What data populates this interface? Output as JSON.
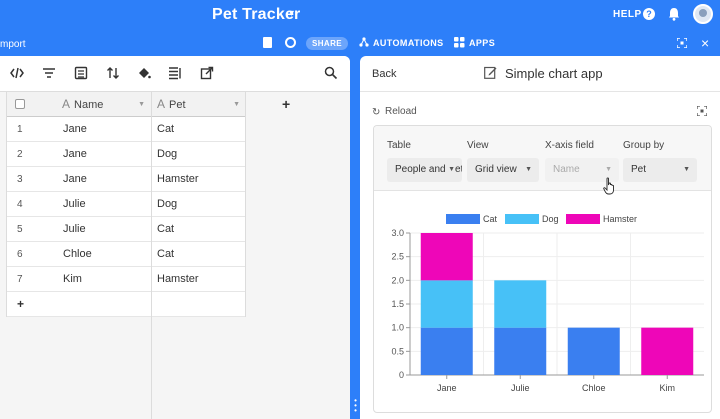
{
  "topbar": {
    "title": "Pet Tracker",
    "help": "HELP",
    "help_glyph": "?"
  },
  "subbar": {
    "import_label": "mport",
    "share_label": "SHARE",
    "automations_label": "AUTOMATIONS",
    "apps_label": "APPS",
    "close_glyph": "×"
  },
  "grid": {
    "columns": [
      {
        "name": "Name",
        "type_glyph": "A"
      },
      {
        "name": "Pet",
        "type_glyph": "A"
      }
    ],
    "rows": [
      {
        "num": "1",
        "name": "Jane",
        "pet": "Cat"
      },
      {
        "num": "2",
        "name": "Jane",
        "pet": "Dog"
      },
      {
        "num": "3",
        "name": "Jane",
        "pet": "Hamster"
      },
      {
        "num": "4",
        "name": "Julie",
        "pet": "Dog"
      },
      {
        "num": "5",
        "name": "Julie",
        "pet": "Cat"
      },
      {
        "num": "6",
        "name": "Chloe",
        "pet": "Cat"
      },
      {
        "num": "7",
        "name": "Kim",
        "pet": "Hamster"
      }
    ],
    "add_row": "+",
    "add_column": "+"
  },
  "app_panel": {
    "back_label": "Back",
    "title": "Simple chart app",
    "reload_label": "Reload",
    "reload_glyph": "↻",
    "config": {
      "table_label": "Table",
      "table_value": "People and Pets",
      "view_label": "View",
      "view_value": "Grid view",
      "xaxis_label": "X-axis field",
      "xaxis_value": "Name",
      "groupby_label": "Group by",
      "groupby_value": "Pet"
    }
  },
  "colors": {
    "accent": "#2d7ff9",
    "cat": "#3a7ff0",
    "dog": "#47c1f7",
    "hamster": "#ee06b8"
  },
  "chart_data": {
    "type": "bar",
    "stacked": true,
    "categories": [
      "Jane",
      "Julie",
      "Chloe",
      "Kim"
    ],
    "series": [
      {
        "name": "Cat",
        "color": "#3a7ff0",
        "values": [
          1,
          1,
          1,
          0
        ]
      },
      {
        "name": "Dog",
        "color": "#47c1f7",
        "values": [
          1,
          1,
          0,
          0
        ]
      },
      {
        "name": "Hamster",
        "color": "#ee06b8",
        "values": [
          1,
          0,
          0,
          1
        ]
      }
    ],
    "ylim": [
      0,
      3
    ],
    "yticks": [
      "0",
      "0.5",
      "1.0",
      "1.5",
      "2.0",
      "2.5",
      "3.0"
    ],
    "legend": "top",
    "grid": true
  }
}
